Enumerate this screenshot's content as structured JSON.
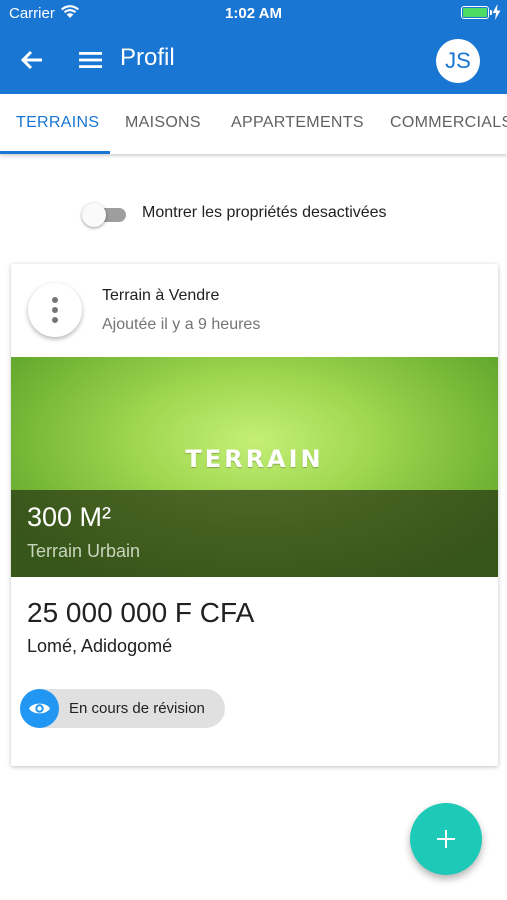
{
  "status_bar": {
    "carrier": "Carrier",
    "time": "1:02 AM",
    "icons": [
      "wifi-icon",
      "battery-icon",
      "charging-bolt-icon"
    ],
    "battery_color": "#4CD964"
  },
  "app_bar": {
    "title": "Profil",
    "avatar_initials": "JS",
    "icons": [
      "arrow-back-icon",
      "menu-icon"
    ],
    "color": "#1976D2"
  },
  "tabs": [
    {
      "label": "TERRAINS",
      "active": true
    },
    {
      "label": "MAISONS",
      "active": false
    },
    {
      "label": "APPARTEMENTS",
      "active": false
    },
    {
      "label": "COMMERCIALS",
      "active": false
    }
  ],
  "toggle": {
    "label": "Montrer les propriétés desactivées",
    "checked": false
  },
  "listing": {
    "title": "Terrain à Vendre",
    "subtitle": "Ajoutée il y a 9 heures",
    "image_text": "TERRAIN",
    "area": "300 M²",
    "area_type": "Terrain Urbain",
    "price": "25 000 000 F CFA",
    "location": "Lomé, Adidogomé",
    "status": "En cours de révision",
    "status_icon": "eye-icon",
    "status_color": "#2196F3"
  },
  "fab": {
    "icon": "plus-icon",
    "color": "#1DC9B7"
  }
}
